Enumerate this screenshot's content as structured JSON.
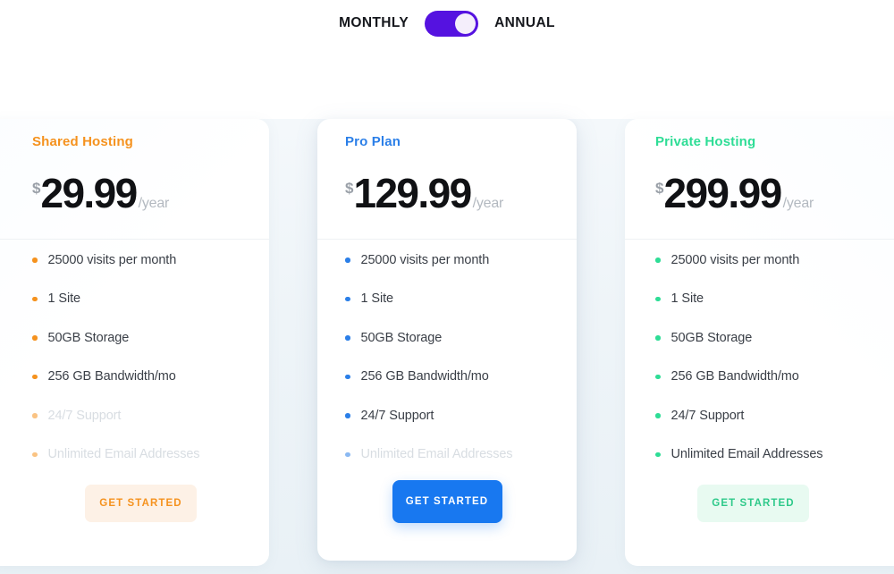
{
  "billing": {
    "monthly_label": "MONTHLY",
    "annual_label": "ANNUAL",
    "selected": "ANNUAL",
    "toggle_color": "#5512e0",
    "knob_color": "#f4eefb"
  },
  "plans": [
    {
      "name": "Shared Hosting",
      "accent": "#f5921e",
      "currency": "$",
      "amount": "29.99",
      "period": "/year",
      "cta_label": "GET STARTED",
      "cta_bg": "#fdf1e6",
      "cta_text_color": "#f5921e",
      "features": [
        {
          "label": "25000 visits per month",
          "enabled": true
        },
        {
          "label": "1 Site",
          "enabled": true
        },
        {
          "label": "50GB Storage",
          "enabled": true
        },
        {
          "label": "256 GB Bandwidth/mo",
          "enabled": true
        },
        {
          "label": "24/7 Support",
          "enabled": false
        },
        {
          "label": "Unlimited Email Addresses",
          "enabled": false
        }
      ]
    },
    {
      "name": "Pro Plan",
      "accent": "#2b7fe8",
      "currency": "$",
      "amount": "129.99",
      "period": "/year",
      "cta_label": "GET STARTED",
      "cta_bg": "#1878f0",
      "cta_text_color": "#ffffff",
      "features": [
        {
          "label": "25000 visits per month",
          "enabled": true
        },
        {
          "label": "1 Site",
          "enabled": true
        },
        {
          "label": "50GB Storage",
          "enabled": true
        },
        {
          "label": "256 GB Bandwidth/mo",
          "enabled": true
        },
        {
          "label": "24/7 Support",
          "enabled": true
        },
        {
          "label": "Unlimited Email Addresses",
          "enabled": false
        }
      ]
    },
    {
      "name": "Private Hosting",
      "accent": "#2edd96",
      "currency": "$",
      "amount": "299.99",
      "period": "/year",
      "cta_label": "GET STARTED",
      "cta_bg": "#e8faf1",
      "cta_text_color": "#2ec98a",
      "features": [
        {
          "label": "25000 visits per month",
          "enabled": true
        },
        {
          "label": "1 Site",
          "enabled": true
        },
        {
          "label": "50GB Storage",
          "enabled": true
        },
        {
          "label": "256 GB Bandwidth/mo",
          "enabled": true
        },
        {
          "label": "24/7 Support",
          "enabled": true
        },
        {
          "label": "Unlimited Email Addresses",
          "enabled": true
        }
      ]
    }
  ]
}
